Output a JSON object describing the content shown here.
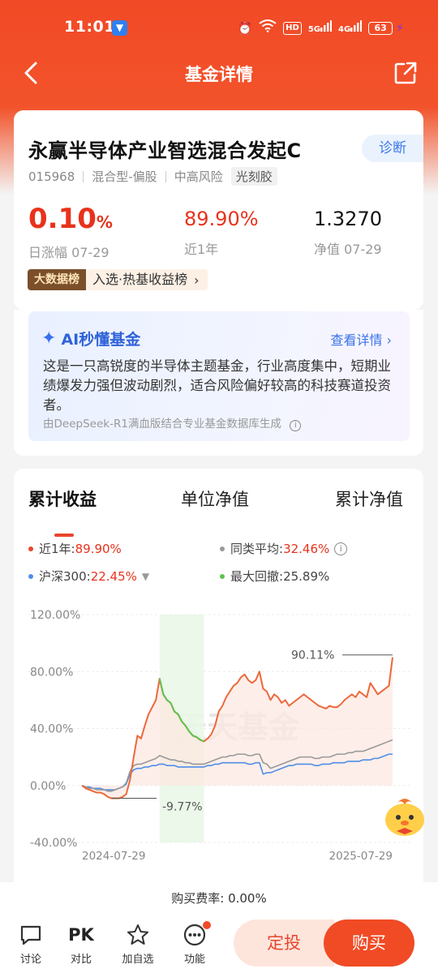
{
  "status_bar": {
    "time": "11:01",
    "battery": "63",
    "network_1": "5G",
    "network_2": "4G",
    "hd": "HD"
  },
  "header": {
    "title": "基金详情"
  },
  "fund": {
    "name": "永赢半导体产业智选混合发起C",
    "diagnose_label": "诊断",
    "code": "015968",
    "type": "混合型-偏股",
    "risk": "中高风险",
    "concept": "光刻胶",
    "daily_change": "0.10",
    "daily_change_unit": "%",
    "daily_change_label": "日涨幅 07-29",
    "one_year_return": "89.90%",
    "one_year_label": "近1年",
    "nav": "1.3270",
    "nav_label": "净值 07-29",
    "rank_badge_left": "大数据榜",
    "rank_badge_right": "入选·热基收益榜"
  },
  "ai": {
    "title": "AI秒懂基金",
    "detail_link": "查看详情",
    "summary": "这是一只高锐度的半导体主题基金，行业高度集中，短期业绩爆发力强但波动剧烈，适合风险偏好较高的科技赛道投资者。",
    "source": "由DeepSeek-R1满血版结合专业基金数据库生成"
  },
  "chart_section": {
    "tabs": [
      "累计收益",
      "单位净值",
      "累计净值"
    ],
    "active_tab": 0,
    "legend": {
      "fund_label": "近1年:",
      "fund_value": "89.90%",
      "peer_label": "同类平均:",
      "peer_value": "32.46%",
      "index_label": "沪深300:",
      "index_value": "22.45%",
      "drawdown_label": "最大回撤:",
      "drawdown_value": "25.89%"
    },
    "watermark": "天天基金"
  },
  "chart_data": {
    "type": "line",
    "x_start": "2024-07-29",
    "x_end": "2025-07-29",
    "y_ticks": [
      "120.00%",
      "80.00%",
      "40.00%",
      "0.00%",
      "-40.00%"
    ],
    "ylim": [
      -40,
      120
    ],
    "annotations": {
      "max": "90.11%",
      "min": "-9.77%"
    },
    "series": [
      {
        "name": "近1年",
        "color": "#ea6a3c",
        "values": [
          0,
          -2,
          -3,
          -4,
          -5,
          -5,
          -6,
          -8,
          -9,
          -9,
          -9,
          -8,
          -6,
          4,
          20,
          35,
          33,
          42,
          50,
          55,
          60,
          75,
          64,
          60,
          58,
          52,
          50,
          45,
          42,
          38,
          35,
          34,
          32,
          31,
          33,
          36,
          42,
          52,
          56,
          62,
          66,
          70,
          72,
          76,
          78,
          74,
          72,
          74,
          80,
          68,
          66,
          60,
          64,
          62,
          58,
          60,
          56,
          58,
          60,
          62,
          64,
          62,
          60,
          58,
          56,
          55,
          54,
          56,
          55,
          55,
          57,
          60,
          62,
          64,
          62,
          66,
          64,
          62,
          72,
          68,
          64,
          66,
          68,
          70,
          90
        ]
      },
      {
        "name": "同类平均",
        "color": "#999999",
        "values": [
          0,
          -1,
          -2,
          -2,
          -3,
          -3,
          -3,
          -4,
          -4,
          -3,
          -2,
          -1,
          2,
          10,
          14,
          15,
          15,
          16,
          17,
          18,
          19,
          21,
          20,
          19,
          18,
          18,
          17,
          17,
          16,
          16,
          15,
          15,
          15,
          15,
          16,
          17,
          18,
          19,
          20,
          20,
          21,
          21,
          22,
          22,
          22,
          21,
          21,
          22,
          22,
          16,
          15,
          12,
          13,
          14,
          15,
          16,
          17,
          18,
          19,
          20,
          20,
          20,
          20,
          19,
          19,
          20,
          20,
          20,
          21,
          22,
          22,
          22,
          23,
          23,
          24,
          24,
          24,
          25,
          26,
          27,
          28,
          29,
          30,
          31,
          32
        ]
      },
      {
        "name": "沪深300",
        "color": "#4f8ee8",
        "values": [
          0,
          -1,
          -1,
          -2,
          -2,
          -2,
          -3,
          -3,
          -3,
          -3,
          -2,
          -1,
          1,
          8,
          11,
          12,
          12,
          13,
          13,
          14,
          14,
          15,
          15,
          14,
          14,
          14,
          13,
          13,
          13,
          13,
          13,
          13,
          13,
          13,
          14,
          14,
          15,
          15,
          16,
          16,
          16,
          16,
          16,
          16,
          16,
          15,
          15,
          16,
          16,
          8,
          9,
          9,
          10,
          11,
          12,
          13,
          14,
          14,
          15,
          15,
          15,
          15,
          15,
          14,
          14,
          15,
          15,
          15,
          16,
          16,
          16,
          16,
          17,
          17,
          17,
          17,
          18,
          18,
          18,
          19,
          19,
          20,
          21,
          22,
          22
        ]
      }
    ],
    "max_drawdown_segment": {
      "start_index": 21,
      "end_index": 33,
      "color": "#5fc24f"
    }
  },
  "bottom": {
    "fee_text": "购买费率: 0.00%",
    "nav_items": [
      "讨论",
      "对比",
      "加自选",
      "功能"
    ],
    "pk_text": "PK",
    "sip_button": "定投",
    "buy_button": "购买"
  },
  "colors": {
    "brand": "#f04b25",
    "rise": "#e8321c",
    "link": "#3a72e6"
  }
}
